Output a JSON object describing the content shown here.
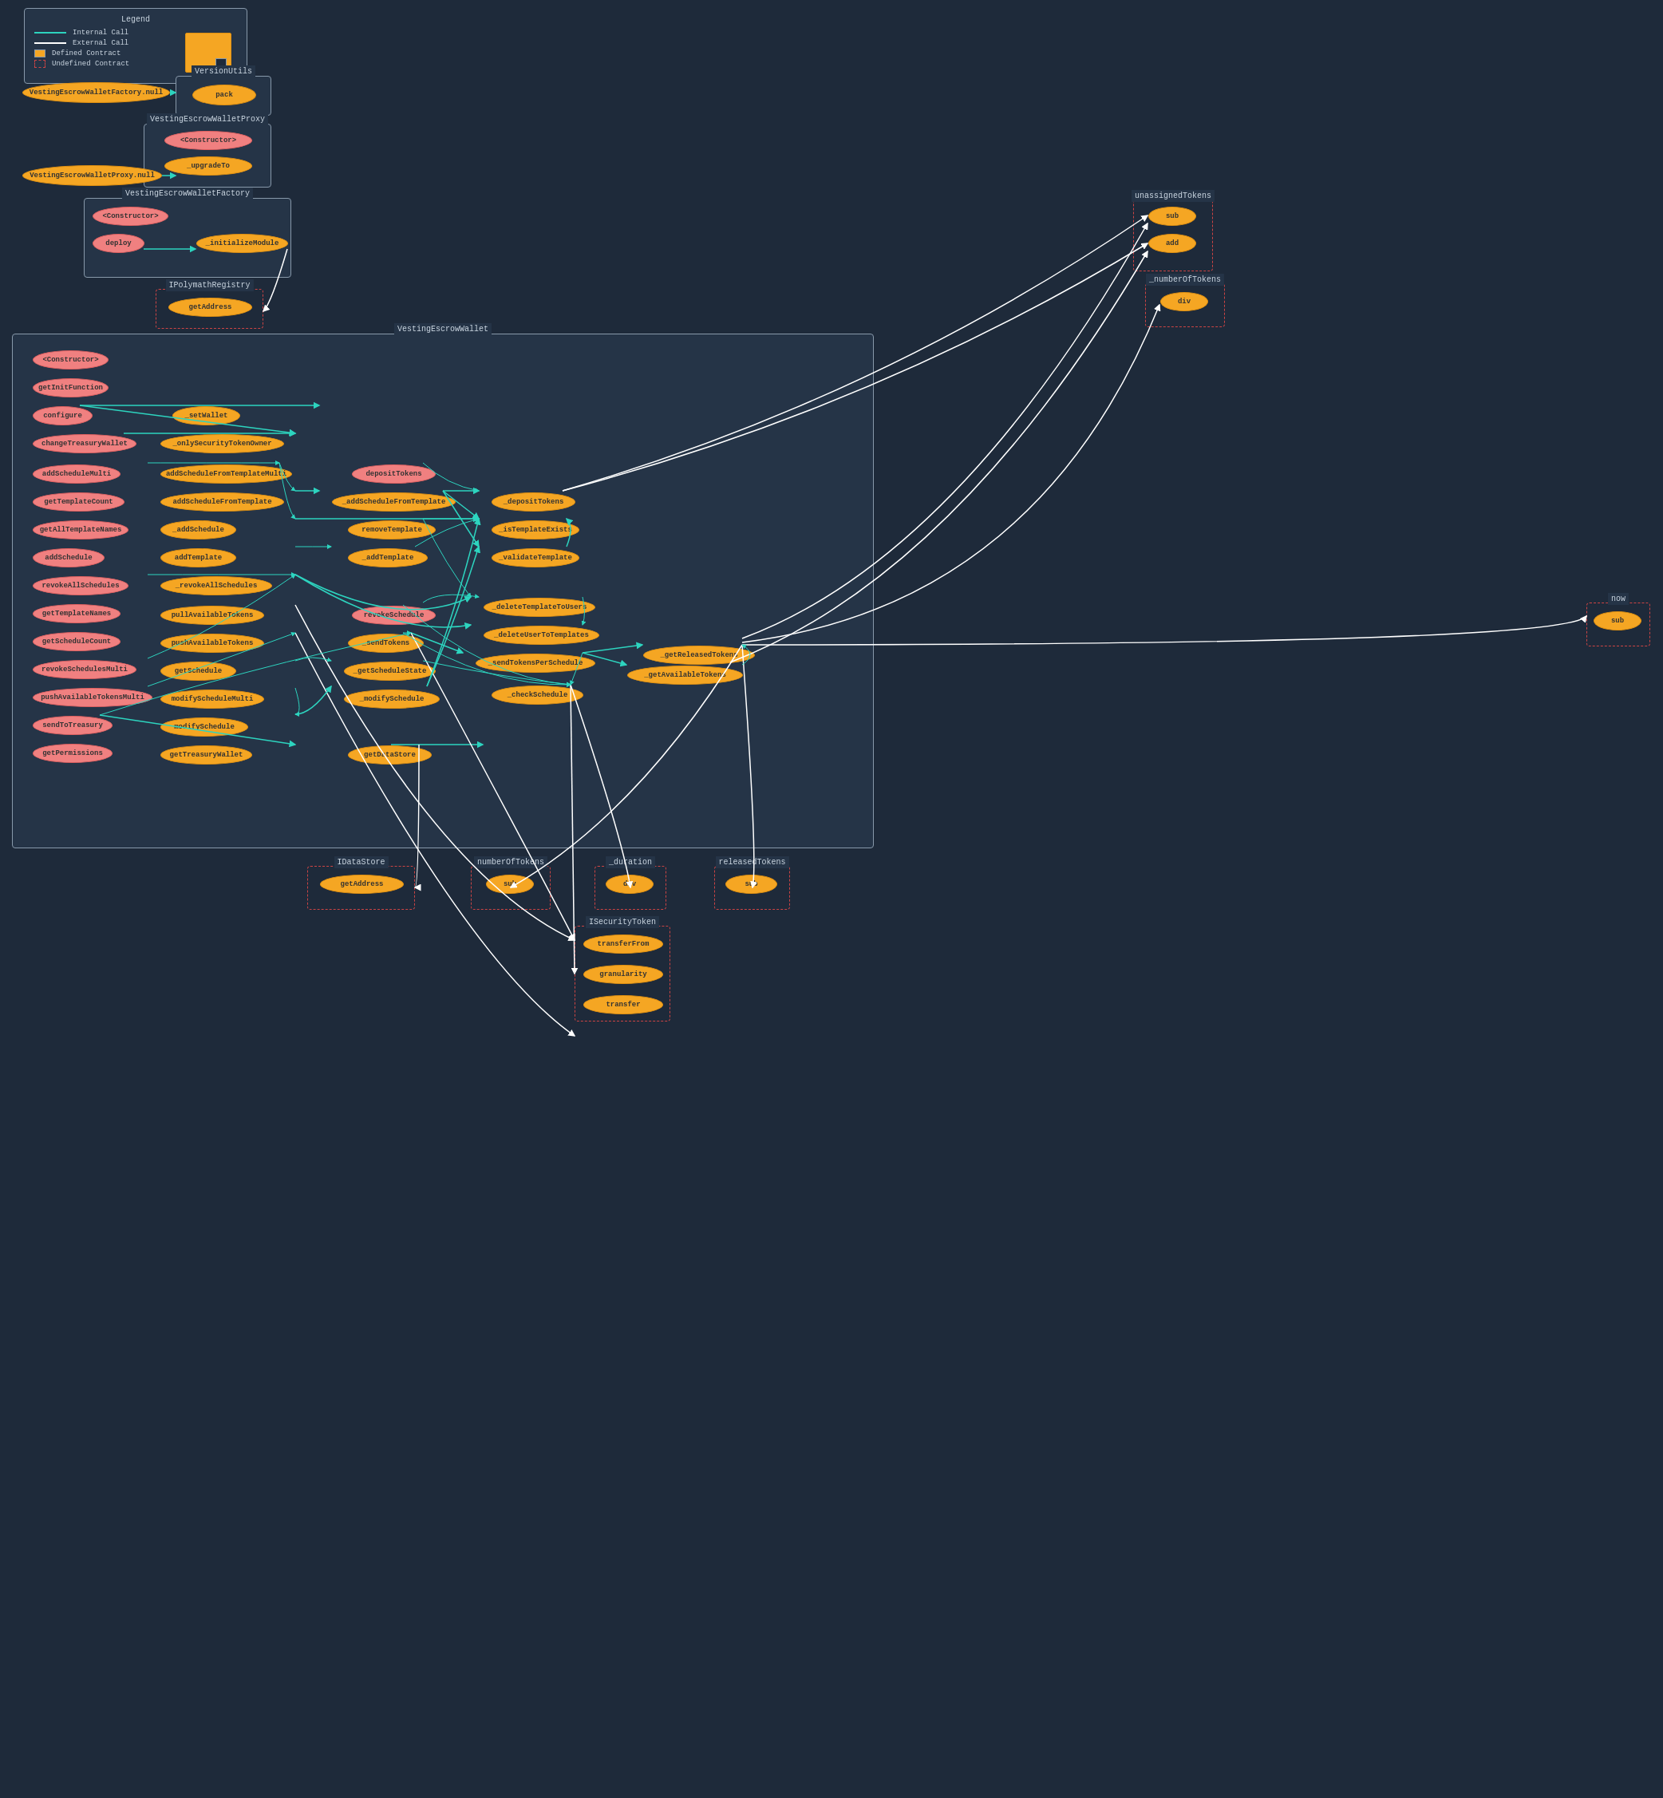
{
  "legend": {
    "title": "Legend",
    "items": [
      {
        "label": "Internal Call",
        "type": "internal-line"
      },
      {
        "label": "External Call",
        "type": "external-line"
      },
      {
        "label": "Defined Contract",
        "type": "defined-box"
      },
      {
        "label": "Undefined Contract",
        "type": "undefined-box"
      }
    ]
  },
  "contracts": {
    "versionUtils": {
      "title": "VersionUtils",
      "nodes": [
        "pack"
      ]
    },
    "vestingEscrowWalletFactory_null": {
      "label": "VestingEscrowWalletFactory.null"
    },
    "vestingEscrowWalletProxy": {
      "title": "VestingEscrowWalletProxy",
      "nodes": [
        "<Constructor>",
        "_upgradeTo"
      ]
    },
    "vestingEscrowWalletProxy_null": {
      "label": "VestingEscrowWalletProxy.null"
    },
    "vestingEscrowWalletFactory": {
      "title": "VestingEscrowWalletFactory",
      "nodes": [
        "<Constructor>",
        "deploy",
        "_initializeModule"
      ]
    },
    "iPolymathRegistry": {
      "title": "IPolymathRegistry",
      "nodes": [
        "getAddress"
      ]
    },
    "vestingEscrowWallet": {
      "title": "VestingEscrowWallet",
      "nodes": [
        "<Constructor>",
        "getInitFunction",
        "configure",
        "changeTreasuryWallet",
        "addScheduleMulti",
        "getTemplateCount",
        "getAllTemplateNames",
        "addSchedule",
        "revokeAllSchedules",
        "getTemplateNames",
        "getScheduleCount",
        "revokeSchedulesMulti",
        "pushAvailableTokensMulti",
        "sendToTreasury",
        "getPermissions",
        "_setWallet",
        "_onlySecurityTokenOwner",
        "addScheduleFromTemplateMulti",
        "addScheduleFromTemplate",
        "_addSchedule",
        "addTemplate",
        "_revokeAllSchedules",
        "pullAvailableTokens",
        "pushAvailableTokens",
        "getSchedule",
        "modifyScheduleMulti",
        "modifySchedule",
        "getTreasuryWallet",
        "depositTokens",
        "_addScheduleFromTemplate",
        "removeTemplate",
        "_addTemplate",
        "revokeSchedule",
        "_sendTokens",
        "_getScheduleState",
        "_modifySchedule",
        "getDataStore",
        "_depositTokens",
        "_isTemplateExists",
        "_validateTemplate",
        "_deleteTemplateToUsers",
        "_deleteUserToTemplates",
        "_sendTokensPerSchedule",
        "_checkSchedule"
      ]
    },
    "unassignedTokens": {
      "title": "unassignedTokens",
      "nodes": [
        "sub",
        "add"
      ]
    },
    "numberOfTokens_top": {
      "title": "_numberOfTokens",
      "nodes": [
        "div"
      ]
    },
    "iDataStore": {
      "title": "IDataStore",
      "nodes": [
        "getAddress"
      ]
    },
    "numberOfTokens_bot": {
      "title": "numberOfTokens",
      "nodes": [
        "sub"
      ]
    },
    "duration": {
      "title": "_duration",
      "nodes": [
        "div"
      ]
    },
    "releasedTokens": {
      "title": "releasedTokens",
      "nodes": [
        "sub"
      ]
    },
    "iSecurityToken": {
      "title": "ISecurityToken",
      "nodes": [
        "transferFrom",
        "granularity",
        "transfer"
      ]
    },
    "now_box": {
      "title": "now",
      "nodes": [
        "sub"
      ]
    },
    "getReleasedTokens": {
      "label": "_getReleasedTokens"
    },
    "getAvailableTokens": {
      "label": "_getAvailableTokens"
    }
  }
}
